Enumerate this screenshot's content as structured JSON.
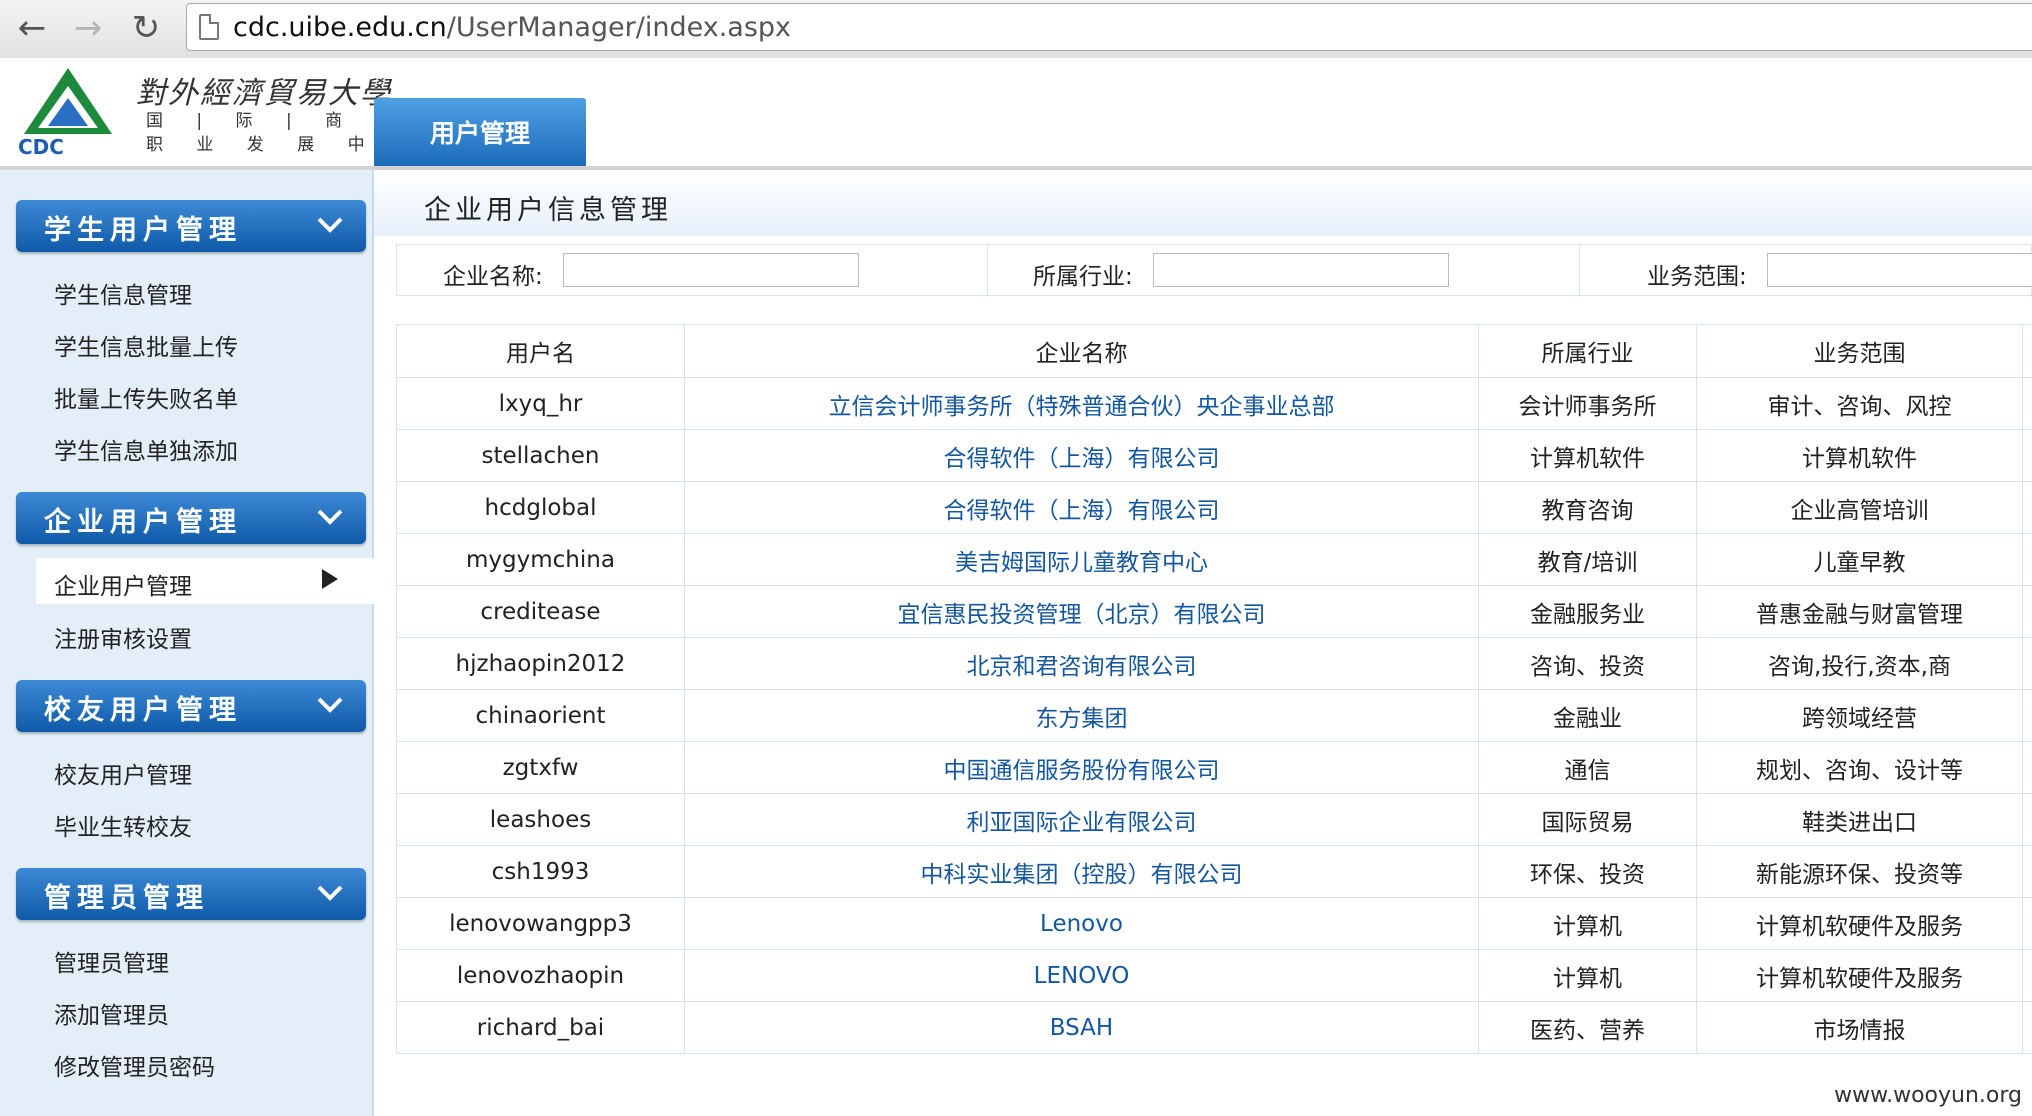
{
  "browser": {
    "url_host": "cdc.uibe.edu.cn",
    "url_path": "/UserManager/index.aspx",
    "back_icon": "←",
    "forward_icon": "→",
    "reload_icon": "↻"
  },
  "header": {
    "school_name": "對外經濟貿易大學",
    "school_sub1": "国 | 际 | 商 | 学 | 院",
    "school_sub2": "职 业 发 展 中 心",
    "logo_text": "CDC",
    "top_tab": "用户管理"
  },
  "sidebar": {
    "sections": [
      {
        "title": "学生用户管理",
        "items": [
          "学生信息管理",
          "学生信息批量上传",
          "批量上传失败名单",
          "学生信息单独添加"
        ]
      },
      {
        "title": "企业用户管理",
        "items": [
          "企业用户管理",
          "注册审核设置"
        ]
      },
      {
        "title": "校友用户管理",
        "items": [
          "校友用户管理",
          "毕业生转校友"
        ]
      },
      {
        "title": "管理员管理",
        "items": [
          "管理员管理",
          "添加管理员",
          "修改管理员密码"
        ]
      }
    ]
  },
  "main": {
    "title": "企业用户信息管理",
    "filters": {
      "company_label": "企业名称:",
      "industry_label": "所属行业:",
      "scope_label": "业务范围:",
      "company_value": "",
      "industry_value": "",
      "scope_value": ""
    },
    "table": {
      "headers": [
        "用户名",
        "企业名称",
        "所属行业",
        "业务范围"
      ],
      "rows": [
        [
          "lxyq_hr",
          "立信会计师事务所（特殊普通合伙）央企事业总部",
          "会计师事务所",
          "审计、咨询、风控"
        ],
        [
          "stellachen",
          "合得软件（上海）有限公司",
          "计算机软件",
          "计算机软件"
        ],
        [
          "hcdglobal",
          "合得软件（上海）有限公司",
          "教育咨询",
          "企业高管培训"
        ],
        [
          "mygymchina",
          "美吉姆国际儿童教育中心",
          "教育/培训",
          "儿童早教"
        ],
        [
          "creditease",
          "宜信惠民投资管理（北京）有限公司",
          "金融服务业",
          "普惠金融与财富管理"
        ],
        [
          "hjzhaopin2012",
          "北京和君咨询有限公司",
          "咨询、投资",
          "咨询,投行,资本,商"
        ],
        [
          "chinaorient",
          "东方集团",
          "金融业",
          "跨领域经营"
        ],
        [
          "zgtxfw",
          "中国通信服务股份有限公司",
          "通信",
          "规划、咨询、设计等"
        ],
        [
          "leashoes",
          "利亚国际企业有限公司",
          "国际贸易",
          "鞋类进出口"
        ],
        [
          "csh1993",
          "中科实业集团（控股）有限公司",
          "环保、投资",
          "新能源环保、投资等"
        ],
        [
          "lenovowangpp3",
          "Lenovo",
          "计算机",
          "计算机软硬件及服务"
        ],
        [
          "lenovozhaopin",
          "LENOVO",
          "计算机",
          "计算机软硬件及服务"
        ],
        [
          "richard_bai",
          "BSAH",
          "医药、营养",
          "市场情报"
        ]
      ]
    }
  },
  "watermark": "www.wooyun.org"
}
